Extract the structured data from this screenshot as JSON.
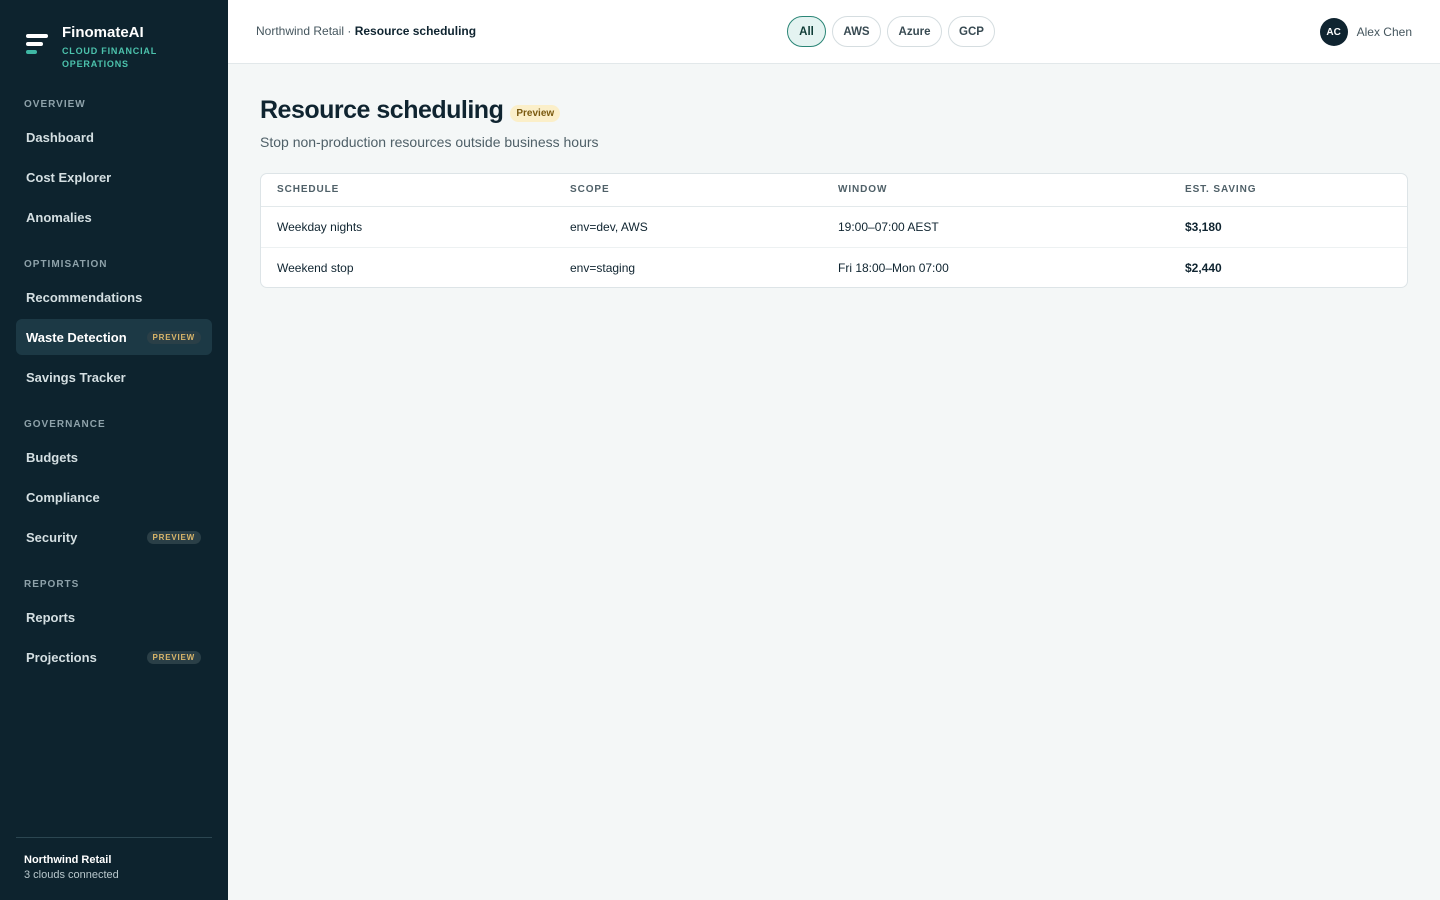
{
  "brand": {
    "name": "FinomateAI",
    "tagline": "Cloud Financial Operations"
  },
  "nav": {
    "sections": [
      {
        "title": "OVERVIEW",
        "items": [
          {
            "label": "Dashboard"
          },
          {
            "label": "Cost Explorer"
          },
          {
            "label": "Anomalies"
          }
        ]
      },
      {
        "title": "OPTIMISATION",
        "items": [
          {
            "label": "Recommendations"
          },
          {
            "label": "Waste Detection",
            "badge": "PREVIEW",
            "active": true
          },
          {
            "label": "Savings Tracker"
          }
        ]
      },
      {
        "title": "GOVERNANCE",
        "items": [
          {
            "label": "Budgets"
          },
          {
            "label": "Compliance"
          },
          {
            "label": "Security",
            "badge": "PREVIEW"
          }
        ]
      },
      {
        "title": "REPORTS",
        "items": [
          {
            "label": "Reports"
          },
          {
            "label": "Projections",
            "badge": "PREVIEW"
          }
        ]
      }
    ]
  },
  "footer": {
    "org": "Northwind Retail",
    "status": "3 clouds connected"
  },
  "topbar": {
    "breadcrumb_org": "Northwind Retail",
    "breadcrumb_sep": " · ",
    "breadcrumb_page": "Resource scheduling",
    "filters": [
      {
        "label": "All",
        "active": true
      },
      {
        "label": "AWS"
      },
      {
        "label": "Azure"
      },
      {
        "label": "GCP"
      }
    ],
    "user": {
      "initials": "AC",
      "name": "Alex Chen"
    }
  },
  "page": {
    "title": "Resource scheduling",
    "badge": "Preview",
    "subtitle": "Stop non-production resources outside business hours"
  },
  "table": {
    "columns": [
      "SCHEDULE",
      "SCOPE",
      "WINDOW",
      "EST. SAVING"
    ],
    "rows": [
      [
        "Weekday nights",
        "env=dev, AWS",
        "19:00–07:00 AEST",
        "$3,180"
      ],
      [
        "Weekend stop",
        "env=staging",
        "Fri 18:00–Mon 07:00",
        "$2,440"
      ]
    ]
  },
  "colors": {
    "sidebar": "#0d232e",
    "accent": "#4cc2ac",
    "badge": "#d9b66a",
    "active_pill": "#2a8576"
  }
}
